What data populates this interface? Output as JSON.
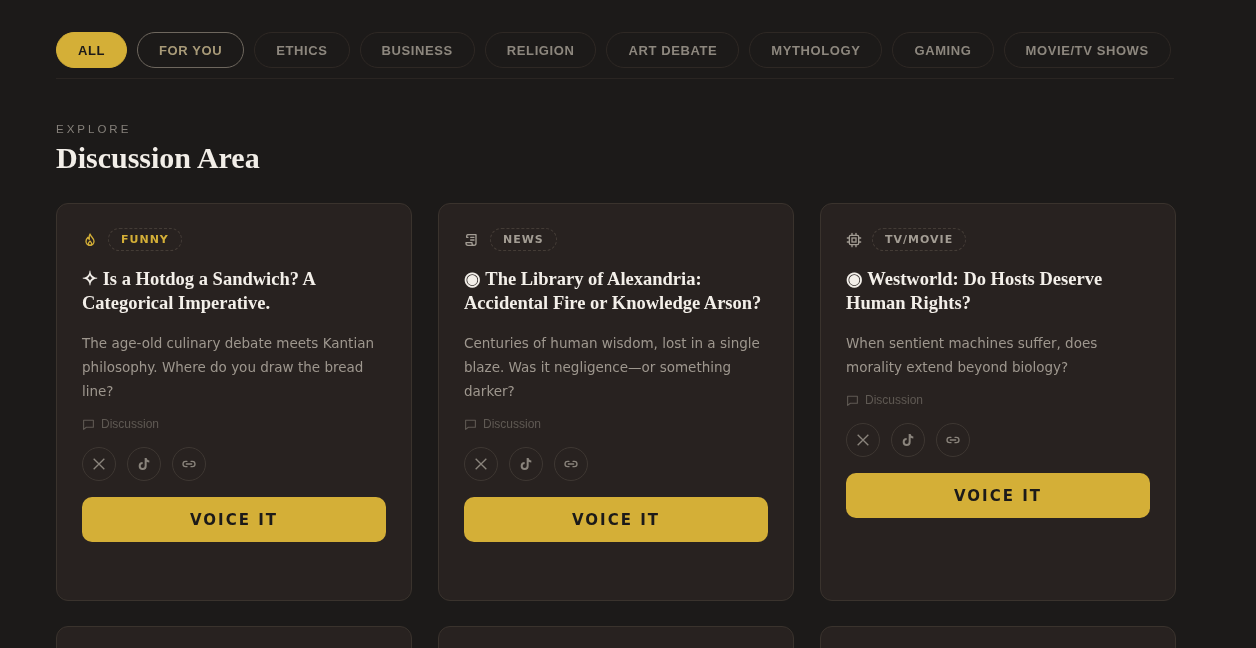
{
  "filters": [
    {
      "label": "ALL",
      "selected": true,
      "hover": false
    },
    {
      "label": "FOR YOU",
      "selected": false,
      "hover": true
    },
    {
      "label": "ETHICS",
      "selected": false,
      "hover": false
    },
    {
      "label": "BUSINESS",
      "selected": false,
      "hover": false
    },
    {
      "label": "RELIGION",
      "selected": false,
      "hover": false
    },
    {
      "label": "ART DEBATE",
      "selected": false,
      "hover": false
    },
    {
      "label": "MYTHOLOGY",
      "selected": false,
      "hover": false
    },
    {
      "label": "GAMING",
      "selected": false,
      "hover": false
    },
    {
      "label": "MOVIE/TV SHOWS",
      "selected": false,
      "hover": false
    }
  ],
  "section": {
    "eyebrow": "EXPLORE",
    "title": "Discussion Area"
  },
  "cards": [
    {
      "kind": "flame",
      "tag": "FUNNY",
      "color": "#d4af37",
      "title": "✧ Is a Hotdog a Sandwich? A Categorical Imperative.",
      "description": "The age-old culinary debate meets Kantian philosophy. Where do you draw the bread line?",
      "meta": "Discussion",
      "button": "VOICE IT"
    },
    {
      "kind": "scroll",
      "tag": "NEWS",
      "color": "#a39d94",
      "title": "◉ The Library of Alexandria: Accidental Fire or Knowledge Arson?",
      "description": "Centuries of human wisdom, lost in a single blaze. Was it negligence—or something darker?",
      "meta": "Discussion",
      "button": "VOICE IT"
    },
    {
      "kind": "chip",
      "tag": "TV/MOVIE",
      "color": "#a39d94",
      "title": "◉ Westworld: Do Hosts Deserve Human Rights?",
      "description": "When sentient machines suffer, does morality extend beyond biology?",
      "meta": "Discussion",
      "button": "VOICE IT"
    }
  ]
}
